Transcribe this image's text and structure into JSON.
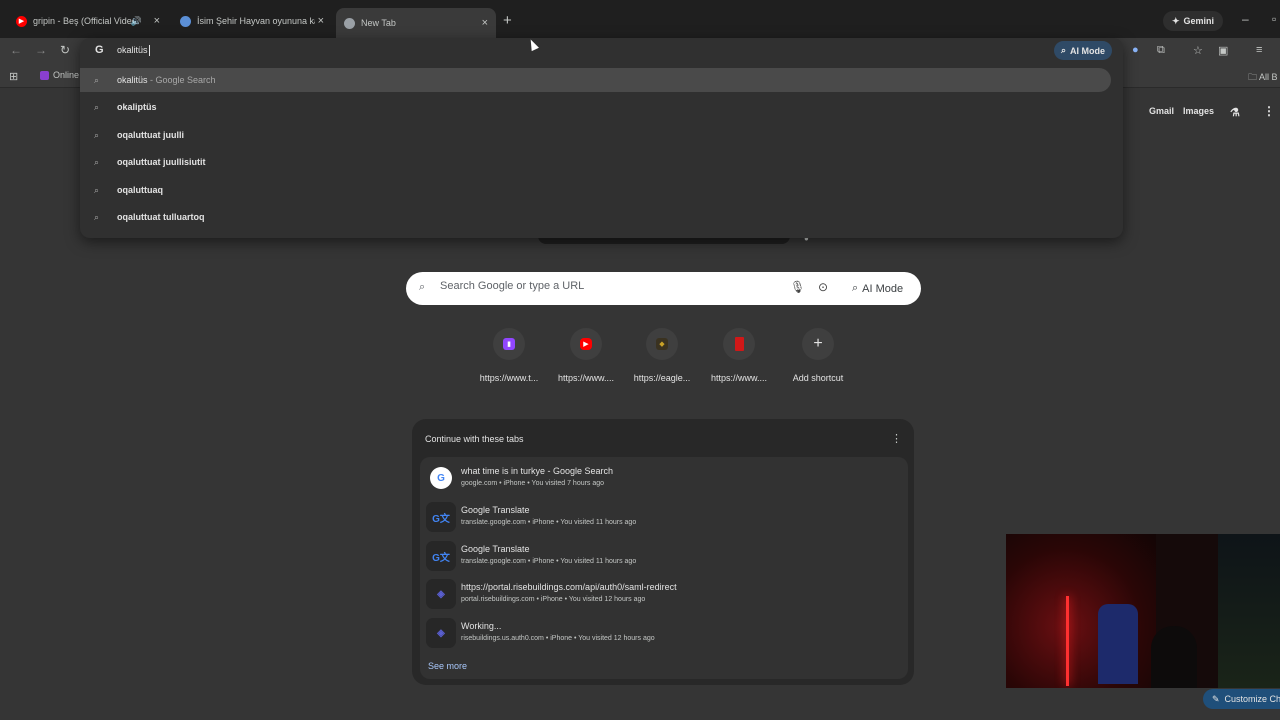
{
  "tabs": [
    {
      "title": "gripin - Beş (Official Video)",
      "icon": "youtube-icon",
      "color": "#ff0000"
    },
    {
      "title": "İsim Şehir Hayvan oyununa katıl",
      "icon": "globe-icon",
      "color": "#5b8fd6"
    },
    {
      "title": "New Tab",
      "icon": "chrome-icon",
      "color": "#9aa0a6"
    }
  ],
  "gemini_label": "Gemini",
  "toolbar": {
    "ai_mode_label": "AI Mode"
  },
  "bookmarks": {
    "item_label": "Online",
    "all_label": "All B"
  },
  "omnibox": {
    "typed_text": "okalitüs",
    "suggestions": [
      {
        "main": "okalitüs",
        "suffix": " - Google Search",
        "bold": false
      },
      {
        "main": "okaliptüs",
        "suffix": "",
        "bold": true
      },
      {
        "main": "oqaluttuat juulli",
        "suffix": "",
        "bold": true
      },
      {
        "main": "oqaluttuat juullisiutit",
        "suffix": "",
        "bold": true
      },
      {
        "main": "oqaluttuaq",
        "suffix": "",
        "bold": true
      },
      {
        "main": "oqaluttuat tulluartoq",
        "suffix": "",
        "bold": true
      }
    ]
  },
  "google_links": {
    "gmail": "Gmail",
    "images": "Images"
  },
  "search": {
    "placeholder": "Search Google or type a URL",
    "ai_mode_label": "AI Mode"
  },
  "shortcuts": [
    {
      "label": "https://www.t...",
      "icon": "twitch-icon",
      "color": "#9146ff"
    },
    {
      "label": "https://www....",
      "icon": "youtube-icon",
      "color": "#ff0000"
    },
    {
      "label": "https://eagle...",
      "icon": "eagle-icon",
      "color": "#c9a227"
    },
    {
      "label": "https://www....",
      "icon": "bookmark-red-icon",
      "color": "#d01818"
    },
    {
      "label": "Add shortcut",
      "icon": "plus-icon",
      "color": "#e3e3e3"
    }
  ],
  "continue_card": {
    "title": "Continue with these tabs",
    "see_more": "See more",
    "rows": [
      {
        "title": "what time is in turkye - Google Search",
        "sub": "google.com • iPhone • You visited 7 hours ago",
        "icon": "google-icon"
      },
      {
        "title": "Google Translate",
        "sub": "translate.google.com • iPhone • You visited 11 hours ago",
        "icon": "google-translate-icon"
      },
      {
        "title": "Google Translate",
        "sub": "translate.google.com • iPhone • You visited 11 hours ago",
        "icon": "google-translate-icon"
      },
      {
        "title": "https://portal.risebuildings.com/api/auth0/saml-redirect",
        "sub": "portal.risebuildings.com • iPhone • You visited 12 hours ago",
        "icon": "rise-icon"
      },
      {
        "title": "Working...",
        "sub": "risebuildings.us.auth0.com • iPhone • You visited 12 hours ago",
        "icon": "rise-icon"
      }
    ]
  },
  "customize_label": "Customize Ch"
}
